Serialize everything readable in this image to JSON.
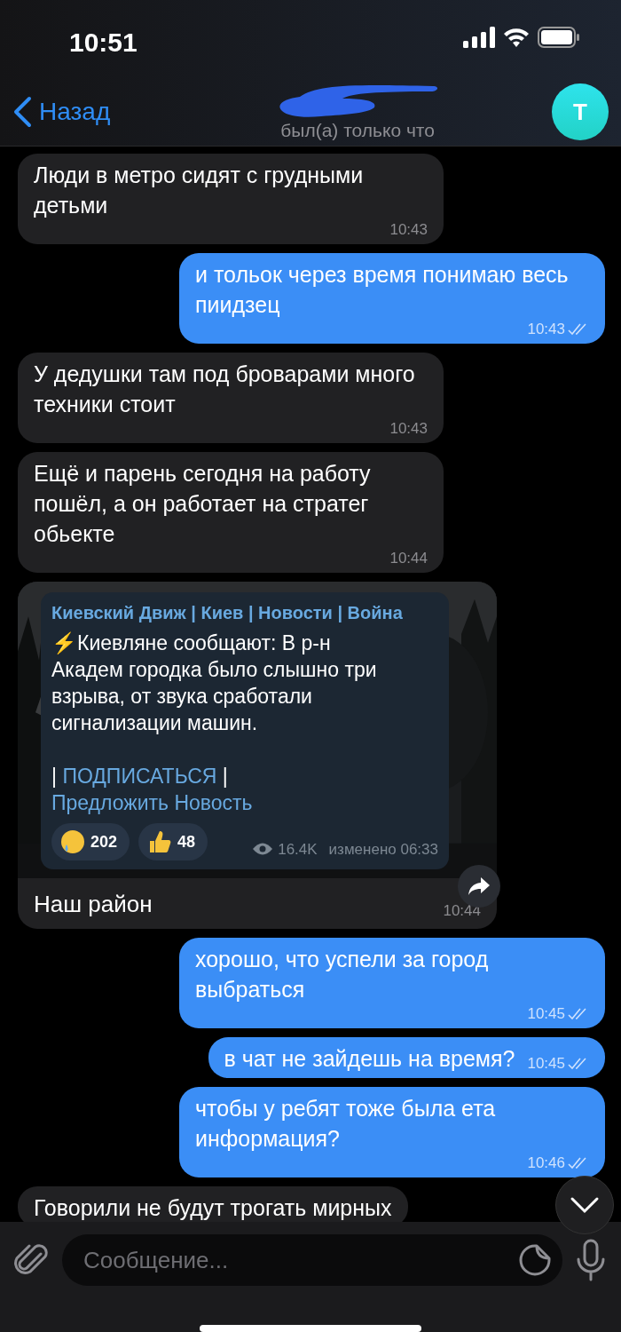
{
  "status_bar": {
    "time": "10:51"
  },
  "header": {
    "back": "Назад",
    "status": "был(а) только что",
    "avatar": "Т"
  },
  "messages": [
    {
      "kind": "in",
      "text": "Люди в метро сидят с грудными детьми",
      "time": "10:43"
    },
    {
      "kind": "out",
      "text": "и тольок через время понимаю весь пиидзец",
      "time": "10:43",
      "read": true
    },
    {
      "kind": "in",
      "text": "У дедушки там под броварами много техники стоит",
      "time": "10:43"
    },
    {
      "kind": "in",
      "text": "Ещё и парень сегодня на работу пошёл, а он работает на стратег обьекте",
      "time": "10:44"
    },
    {
      "kind": "forward",
      "channel": "Киевский Движ | Киев | Новости | Война",
      "text": "⚡Киевляне сообщают: В р-н Академ городка было слышно три взрыва, от звука сработали сигнализации машин.",
      "links": [
        {
          "kind": "sep",
          "text": "|"
        },
        {
          "kind": "link",
          "text": "ПОДПИСАТЬСЯ"
        },
        {
          "kind": "sep",
          "text": "|"
        },
        {
          "kind": "link",
          "text": "Предложить Новость"
        }
      ],
      "reactions": [
        {
          "kind": "crying",
          "count": "202"
        },
        {
          "kind": "thumbs-up",
          "count": "48"
        }
      ],
      "views": "16.4K",
      "edited": "изменено 06:33",
      "caption": "Наш район",
      "time": "10:44"
    },
    {
      "kind": "out",
      "text": "хорошо, что успели за город выбраться",
      "time": "10:45",
      "read": true
    },
    {
      "kind": "out",
      "text": "в чат не зайдешь на время?",
      "time": "10:45",
      "read": true
    },
    {
      "kind": "out",
      "text": "чтобы у ребят тоже была ета информация?",
      "time": "10:46",
      "read": true
    },
    {
      "kind": "in",
      "text": "Говорили не будут трогать мирных"
    }
  ],
  "composer": {
    "placeholder": "Сообщение..."
  }
}
